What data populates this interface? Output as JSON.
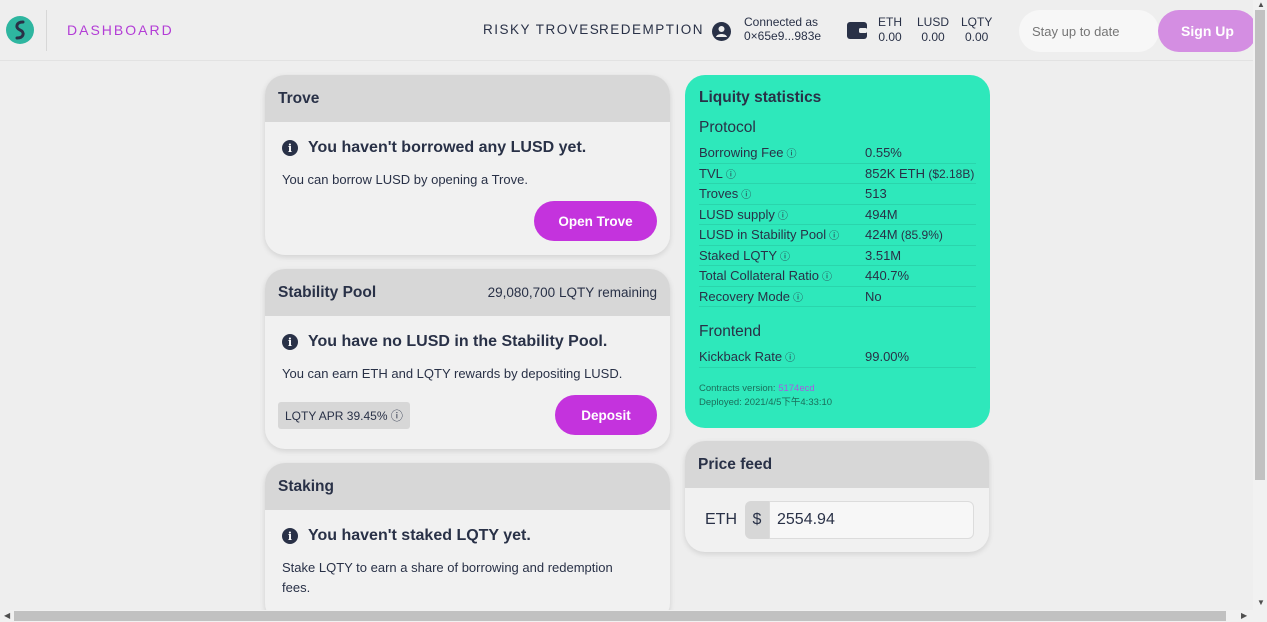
{
  "header": {
    "dashboard": "DASHBOARD",
    "nav": [
      "RISKY TROVES",
      "REDEMPTION"
    ],
    "account": {
      "line1": "Connected as",
      "line2": "0×65e9...983e"
    },
    "balances": [
      {
        "token": "ETH",
        "value": "0.00"
      },
      {
        "token": "LUSD",
        "value": "0.00"
      },
      {
        "token": "LQTY",
        "value": "0.00"
      }
    ],
    "subscribe_placeholder": "Stay up to date",
    "signup": "Sign Up"
  },
  "trove": {
    "title": "Trove",
    "info": "You haven't borrowed any LUSD yet.",
    "desc": "You can borrow LUSD by opening a Trove.",
    "button": "Open Trove"
  },
  "stability": {
    "title": "Stability Pool",
    "remaining": "29,080,700 LQTY remaining",
    "info": "You have no LUSD in the Stability Pool.",
    "desc": "You can earn ETH and LQTY rewards by depositing LUSD.",
    "apr": "LQTY APR 39.45% ⓘ",
    "button": "Deposit"
  },
  "staking": {
    "title": "Staking",
    "info": "You haven't staked LQTY yet.",
    "desc": "Stake LQTY to earn a share of borrowing and redemption fees."
  },
  "stats": {
    "title": "Liquity statistics",
    "protocol_title": "Protocol",
    "protocol": [
      {
        "k": "Borrowing Fee",
        "v": "0.55%",
        "s": ""
      },
      {
        "k": "TVL",
        "v": "852K ETH",
        "s": " ($2.18B)"
      },
      {
        "k": "Troves",
        "v": "513",
        "s": ""
      },
      {
        "k": "LUSD supply",
        "v": "494M",
        "s": ""
      },
      {
        "k": "LUSD in Stability Pool",
        "v": "424M",
        "s": " (85.9%)"
      },
      {
        "k": "Staked LQTY",
        "v": "3.51M",
        "s": ""
      },
      {
        "k": "Total Collateral Ratio",
        "v": "440.7%",
        "s": ""
      },
      {
        "k": "Recovery Mode",
        "v": "No",
        "s": ""
      }
    ],
    "frontend_title": "Frontend",
    "frontend": [
      {
        "k": "Kickback Rate",
        "v": "99.00%",
        "s": ""
      }
    ],
    "contracts_label": "Contracts version: ",
    "contracts_hash": "5174ecd",
    "deployed": "Deployed: 2021/4/5下午4:33:10"
  },
  "price": {
    "title": "Price feed",
    "asset": "ETH",
    "currency": "$",
    "value": "2554.94"
  },
  "colors": {
    "accent": "#c433dd",
    "stats_bg": "#2ee8bb",
    "text": "#293147"
  }
}
